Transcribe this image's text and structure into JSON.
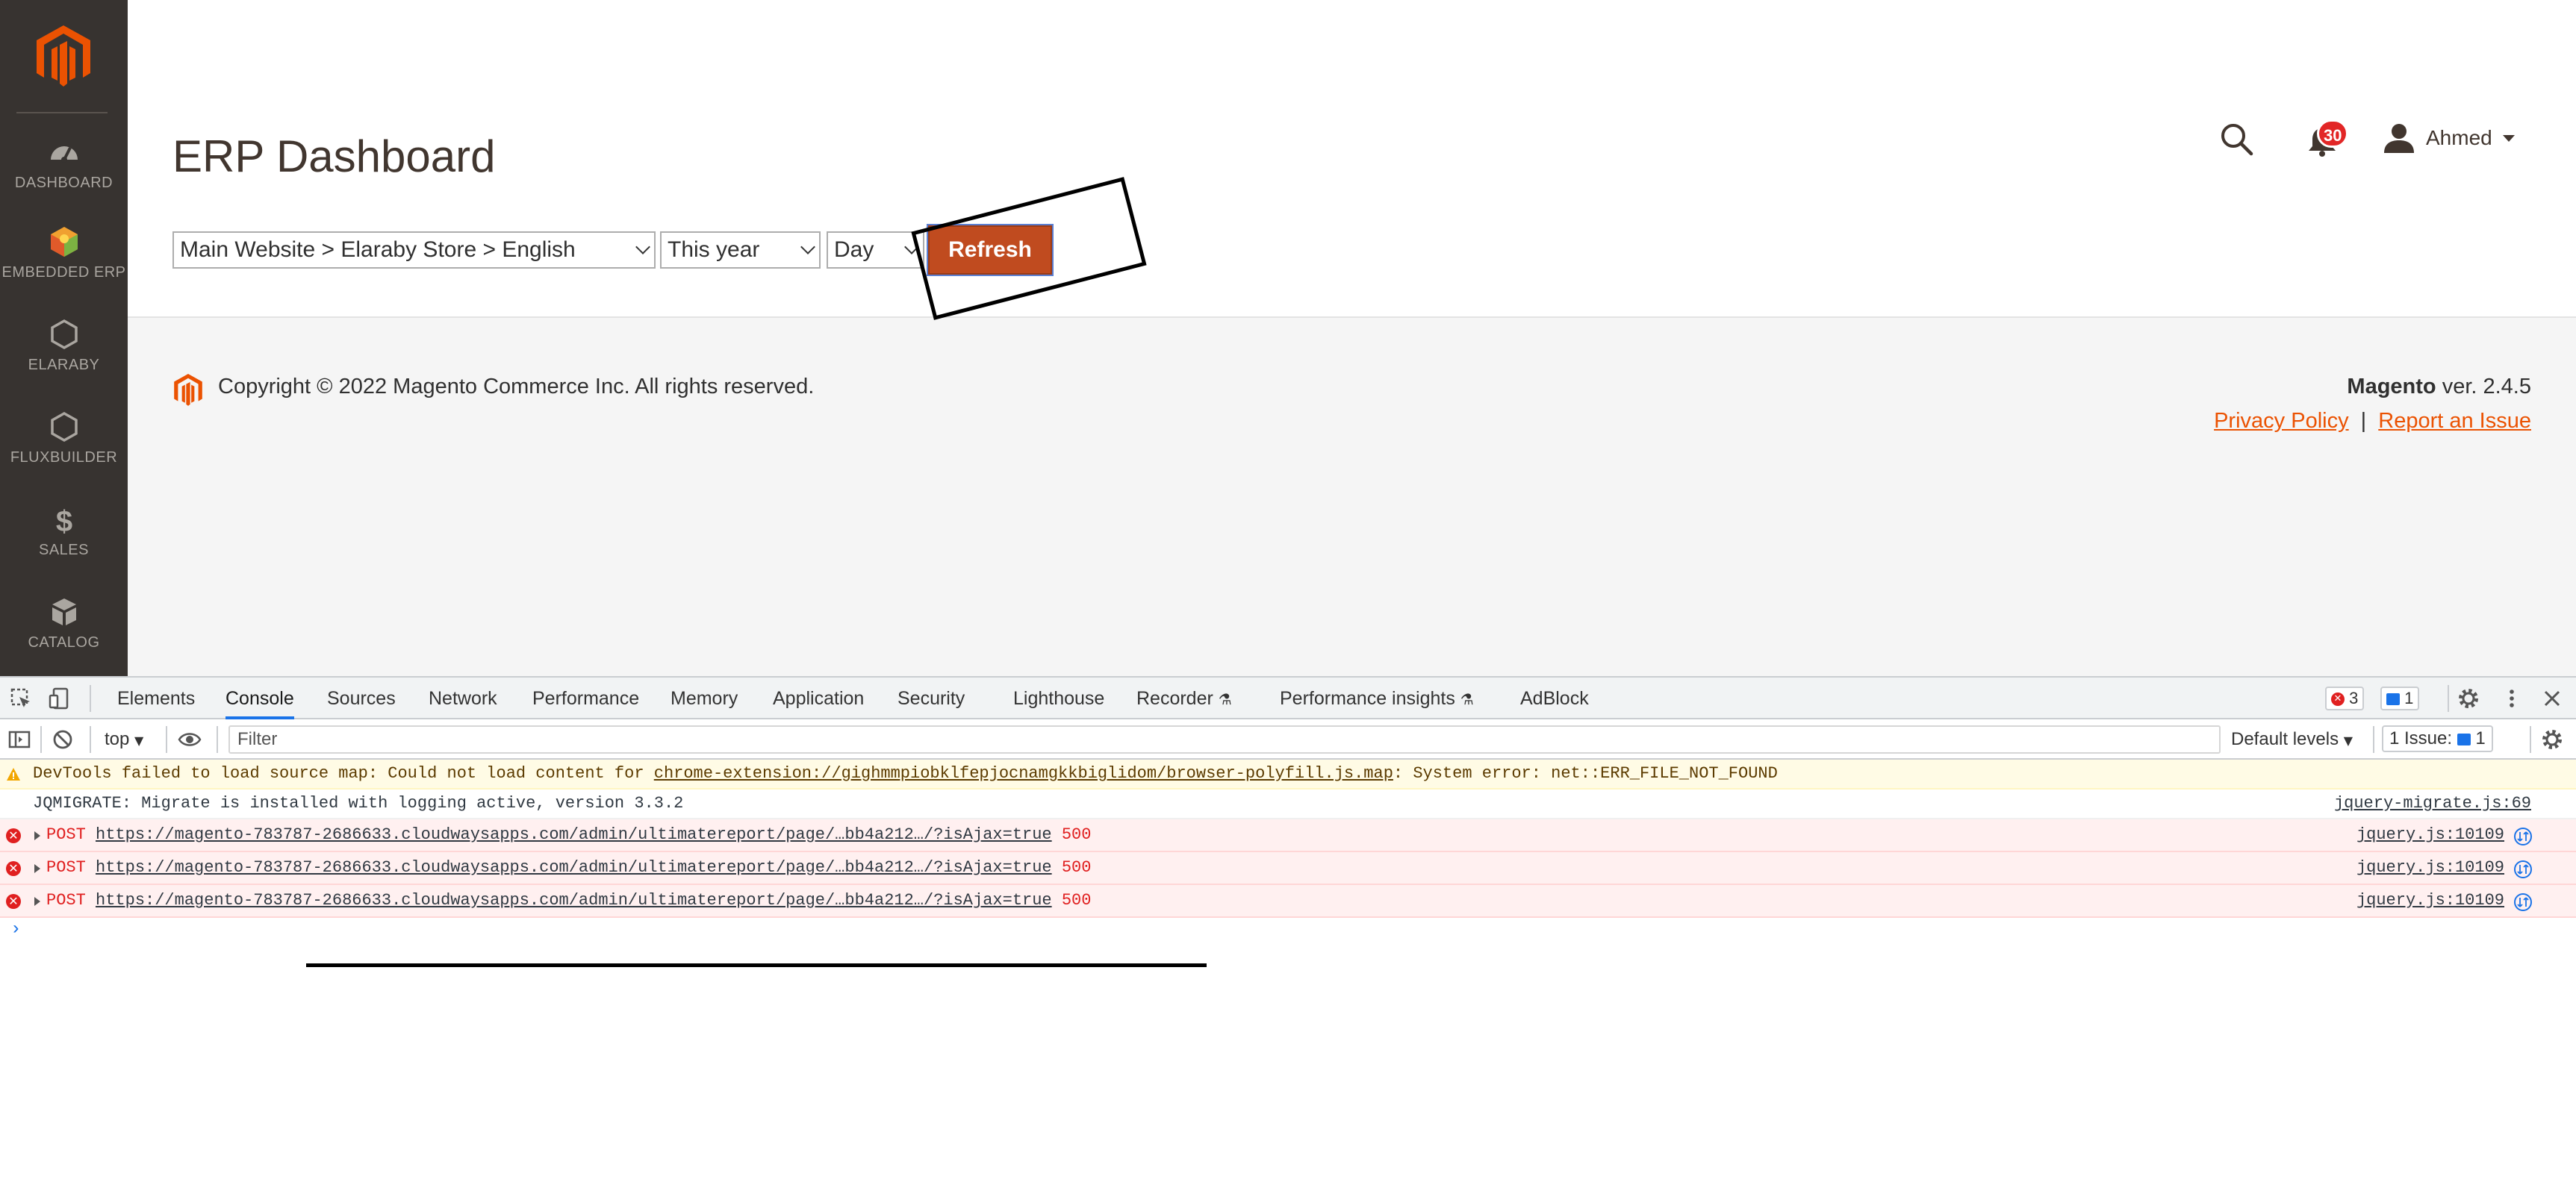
{
  "sidebar": {
    "items": [
      {
        "label": "DASHBOARD",
        "icon": "dashboard-gauge-icon"
      },
      {
        "label": "EMBEDDED ERP",
        "icon": "erp-cube-icon"
      },
      {
        "label": "ELARABY",
        "icon": "hexagon-icon"
      },
      {
        "label": "FLUXBUILDER",
        "icon": "hexagon-icon"
      },
      {
        "label": "SALES",
        "icon": "dollar-icon"
      },
      {
        "label": "CATALOG",
        "icon": "box-icon"
      }
    ]
  },
  "header": {
    "title": "ERP Dashboard",
    "notifications_count": "30",
    "user_name": "Ahmed"
  },
  "filters": {
    "store": "Main Website > Elaraby Store > English",
    "period": "This year",
    "granularity": "Day",
    "refresh_label": "Refresh"
  },
  "footer": {
    "copyright": "Copyright © 2022 Magento Commerce Inc. All rights reserved.",
    "brand": "Magento",
    "version": " ver. 2.4.5",
    "privacy": "Privacy Policy",
    "separator": "|",
    "report": "Report an Issue"
  },
  "devtools": {
    "tabs": [
      "Elements",
      "Console",
      "Sources",
      "Network",
      "Performance",
      "Memory",
      "Application",
      "Security",
      "Lighthouse",
      "Recorder",
      "Performance insights",
      "AdBlock"
    ],
    "active_tab": "Console",
    "error_count": "3",
    "message_count": "1",
    "context": "top",
    "filter_placeholder": "Filter",
    "levels": "Default levels",
    "issues_label": "1 Issue:",
    "issues_count": "1",
    "logs": {
      "warning": {
        "prefix": "DevTools failed to load source map: Could not load content for ",
        "link": "chrome-extension://gighmmpiobklfepjocnamgkkbiglidom/browser-polyfill.js.map",
        "suffix": ": System error: net::ERR_FILE_NOT_FOUND"
      },
      "info": {
        "text": "JQMIGRATE: Migrate is installed with logging active, version 3.3.2",
        "source": "jquery-migrate.js:69"
      },
      "errors": [
        {
          "method": "POST",
          "url": "https://magento-783787-2686633.cloudwaysapps.com/admin/ultimatereport/page/…bb4a212…/?isAjax=true",
          "status": "500",
          "source": "jquery.js:10109"
        },
        {
          "method": "POST",
          "url": "https://magento-783787-2686633.cloudwaysapps.com/admin/ultimatereport/page/…bb4a212…/?isAjax=true",
          "status": "500",
          "source": "jquery.js:10109"
        },
        {
          "method": "POST",
          "url": "https://magento-783787-2686633.cloudwaysapps.com/admin/ultimatereport/page/…bb4a212…/?isAjax=true",
          "status": "500",
          "source": "jquery.js:10109"
        }
      ]
    }
  }
}
